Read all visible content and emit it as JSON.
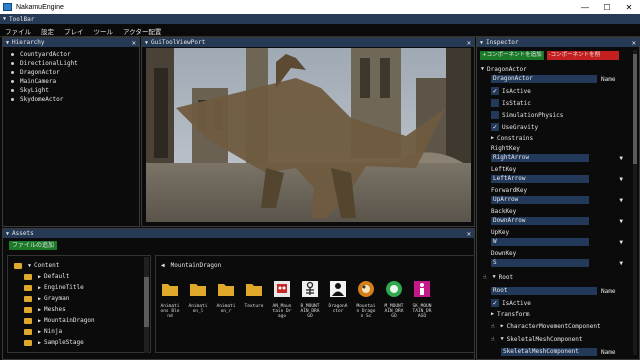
{
  "window": {
    "title": "NakamuEngine",
    "controls": [
      "—",
      "☐",
      "✕"
    ]
  },
  "toolbar": {
    "title": "ToolBar",
    "menu": [
      "ファイル",
      "設定",
      "プレイ",
      "ツール",
      "アクター配置"
    ]
  },
  "hierarchy": {
    "title": "Hierarchy",
    "items": [
      "CountyardActor",
      "DirectionalLight",
      "DragonActor",
      "MainCamera",
      "SkyLight",
      "SkydomeActor"
    ]
  },
  "viewport": {
    "title": "GuiToolViewPort"
  },
  "assets": {
    "title": "Assets",
    "add_button": "ファイルの追加",
    "tree": [
      {
        "label": "Content",
        "indent": 0,
        "arrow": "▼"
      },
      {
        "label": "Default",
        "indent": 1,
        "arrow": "▶"
      },
      {
        "label": "EngineTitle",
        "indent": 1,
        "arrow": "▶"
      },
      {
        "label": "Grayman",
        "indent": 1,
        "arrow": "▶"
      },
      {
        "label": "Meshes",
        "indent": 1,
        "arrow": "▶"
      },
      {
        "label": "MountainDragon",
        "indent": 1,
        "arrow": "▶"
      },
      {
        "label": "Ninja",
        "indent": 1,
        "arrow": "▶"
      },
      {
        "label": "SampleStage",
        "indent": 1,
        "arrow": "▶"
      }
    ],
    "breadcrumb": "MountainDragon",
    "files": [
      {
        "name": "Animations Blend",
        "icon": "folder-icon"
      },
      {
        "name": "Animation_l",
        "icon": "folder-icon"
      },
      {
        "name": "Animation_r",
        "icon": "folder-icon"
      },
      {
        "name": "Texture",
        "icon": "folder-icon"
      },
      {
        "name": "AN_Mountain Drago",
        "icon": "robot-icon"
      },
      {
        "name": "B_MOUNTAIN_DRAGO",
        "icon": "skeleton-icon"
      },
      {
        "name": "DragonActor",
        "icon": "actor-icon"
      },
      {
        "name": "Mountain Dragon Sc",
        "icon": "material-icon"
      },
      {
        "name": "M_MOUNTAIN_DRAGO",
        "icon": "material-green-icon"
      },
      {
        "name": "SK_MOUNTAIN_DRAGO",
        "icon": "mesh-icon"
      }
    ]
  },
  "inspector": {
    "title": "Inspector",
    "add_component": "+コンポーネントを追加",
    "remove_component": "-コンポーネントを削",
    "actor_header": "DragonActor",
    "name_value": "DragonActor",
    "name_label": "Name",
    "checks": [
      {
        "label": "IsActive",
        "checked": true
      },
      {
        "label": "IsStatic",
        "checked": false
      },
      {
        "label": "SimulationPhysics",
        "checked": false
      },
      {
        "label": "UseGravity",
        "checked": true
      }
    ],
    "constrains": "Constrains",
    "keys": [
      {
        "label": "RightKey",
        "value": "RightArrow"
      },
      {
        "label": "LeftKey",
        "value": "LeftArrow"
      },
      {
        "label": "ForwardKey",
        "value": "UpArrow"
      },
      {
        "label": "BackKey",
        "value": "DownArrow"
      },
      {
        "label": "UpKey",
        "value": "W"
      },
      {
        "label": "DownKey",
        "value": "S"
      }
    ],
    "root": "Root",
    "root_name_value": "Root",
    "root_name_label": "Name",
    "root_isactive": "IsActive",
    "transform": "Transform",
    "char_move": "CharacterMovementComponent",
    "skeletal": "SkeletalMeshComponent",
    "skeletal_name_value": "SkeletalMeshComponent",
    "skeletal_name_label": "Name"
  },
  "colors": {
    "title_bar_blue": "#263a56",
    "field_blue": "#22395a",
    "add_green": "#1b7a28",
    "remove_red": "#c42020",
    "folder_yellow": "#e0a92b"
  }
}
